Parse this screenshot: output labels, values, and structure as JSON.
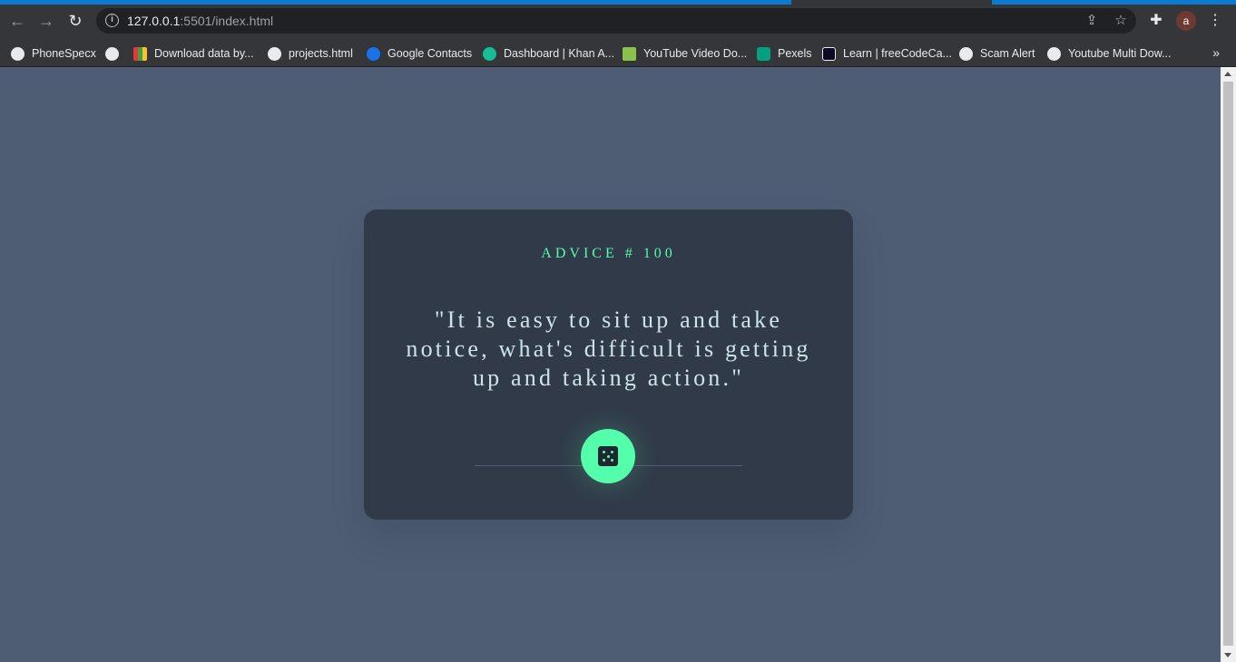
{
  "browser": {
    "url_host": "127.0.0.1",
    "url_rest": ":5501/index.html",
    "profile_initial": "a",
    "bookmarks": [
      {
        "label": "PhoneSpecx",
        "color": "#e8eaed"
      },
      {
        "label": "",
        "color": "#e8eaed"
      },
      {
        "label": "Download data by...",
        "color": "#e53935"
      },
      {
        "label": "projects.html",
        "color": "#e8eaed"
      },
      {
        "label": "Google Contacts",
        "color": "#1a73e8"
      },
      {
        "label": "Dashboard | Khan A...",
        "color": "#14bf96"
      },
      {
        "label": "YouTube Video Do...",
        "color": "#8bc34a"
      },
      {
        "label": "Pexels",
        "color": "#05a081"
      },
      {
        "label": "Learn | freeCodeCa...",
        "color": "#0a0a23"
      },
      {
        "label": "Scam Alert",
        "color": "#e8eaed"
      },
      {
        "label": "Youtube Multi Dow...",
        "color": "#e8eaed"
      }
    ],
    "more": "»"
  },
  "advice": {
    "id_label": "ADVICE # 100",
    "text": "\"It is easy to sit up and take notice, what's difficult is getting up and taking action.\""
  },
  "colors": {
    "accent": "#53ffab",
    "card": "#313a49",
    "background": "#4e5d73",
    "text": "#cee3e9"
  },
  "icons": {
    "back": "arrow-left-icon",
    "forward": "arrow-right-icon",
    "reload": "reload-icon",
    "dice": "dice-icon"
  }
}
